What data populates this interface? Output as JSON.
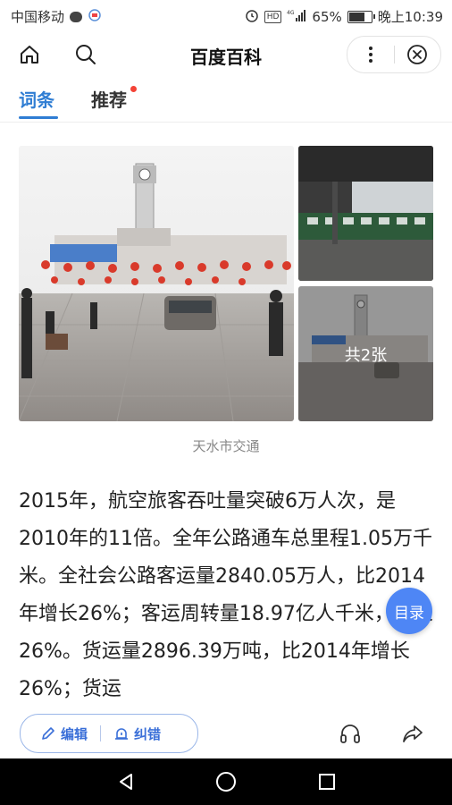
{
  "status_bar": {
    "carrier": "中国移动",
    "network": "4G",
    "hd": "HD",
    "battery": "65%",
    "battery_level": 0.65,
    "time": "晚上10:39"
  },
  "header": {
    "title": "百度百科"
  },
  "tabs": [
    {
      "label": "词条",
      "active": true
    },
    {
      "label": "推荐",
      "active": false,
      "has_dot": true
    }
  ],
  "gallery": {
    "count_label": "共2张",
    "caption": "天水市交通"
  },
  "article": {
    "text": "2015年，航空旅客吞吐量突破6万人次，是2010年的11倍。全年公路通车总里程1.05万千米。全社会公路客运量2840.05万人，比2014年增长26%；客运周转量18.97亿人千米，增长26%。货运量2896.39万吨，比2014年增长26%；货运"
  },
  "toc_button": {
    "label": "目录"
  },
  "toolbar": {
    "edit_label": "编辑",
    "correct_label": "纠错"
  },
  "colors": {
    "accent": "#2f7dd3",
    "toc_bg": "#4e86f5",
    "pill_text": "#3a6fd8"
  }
}
